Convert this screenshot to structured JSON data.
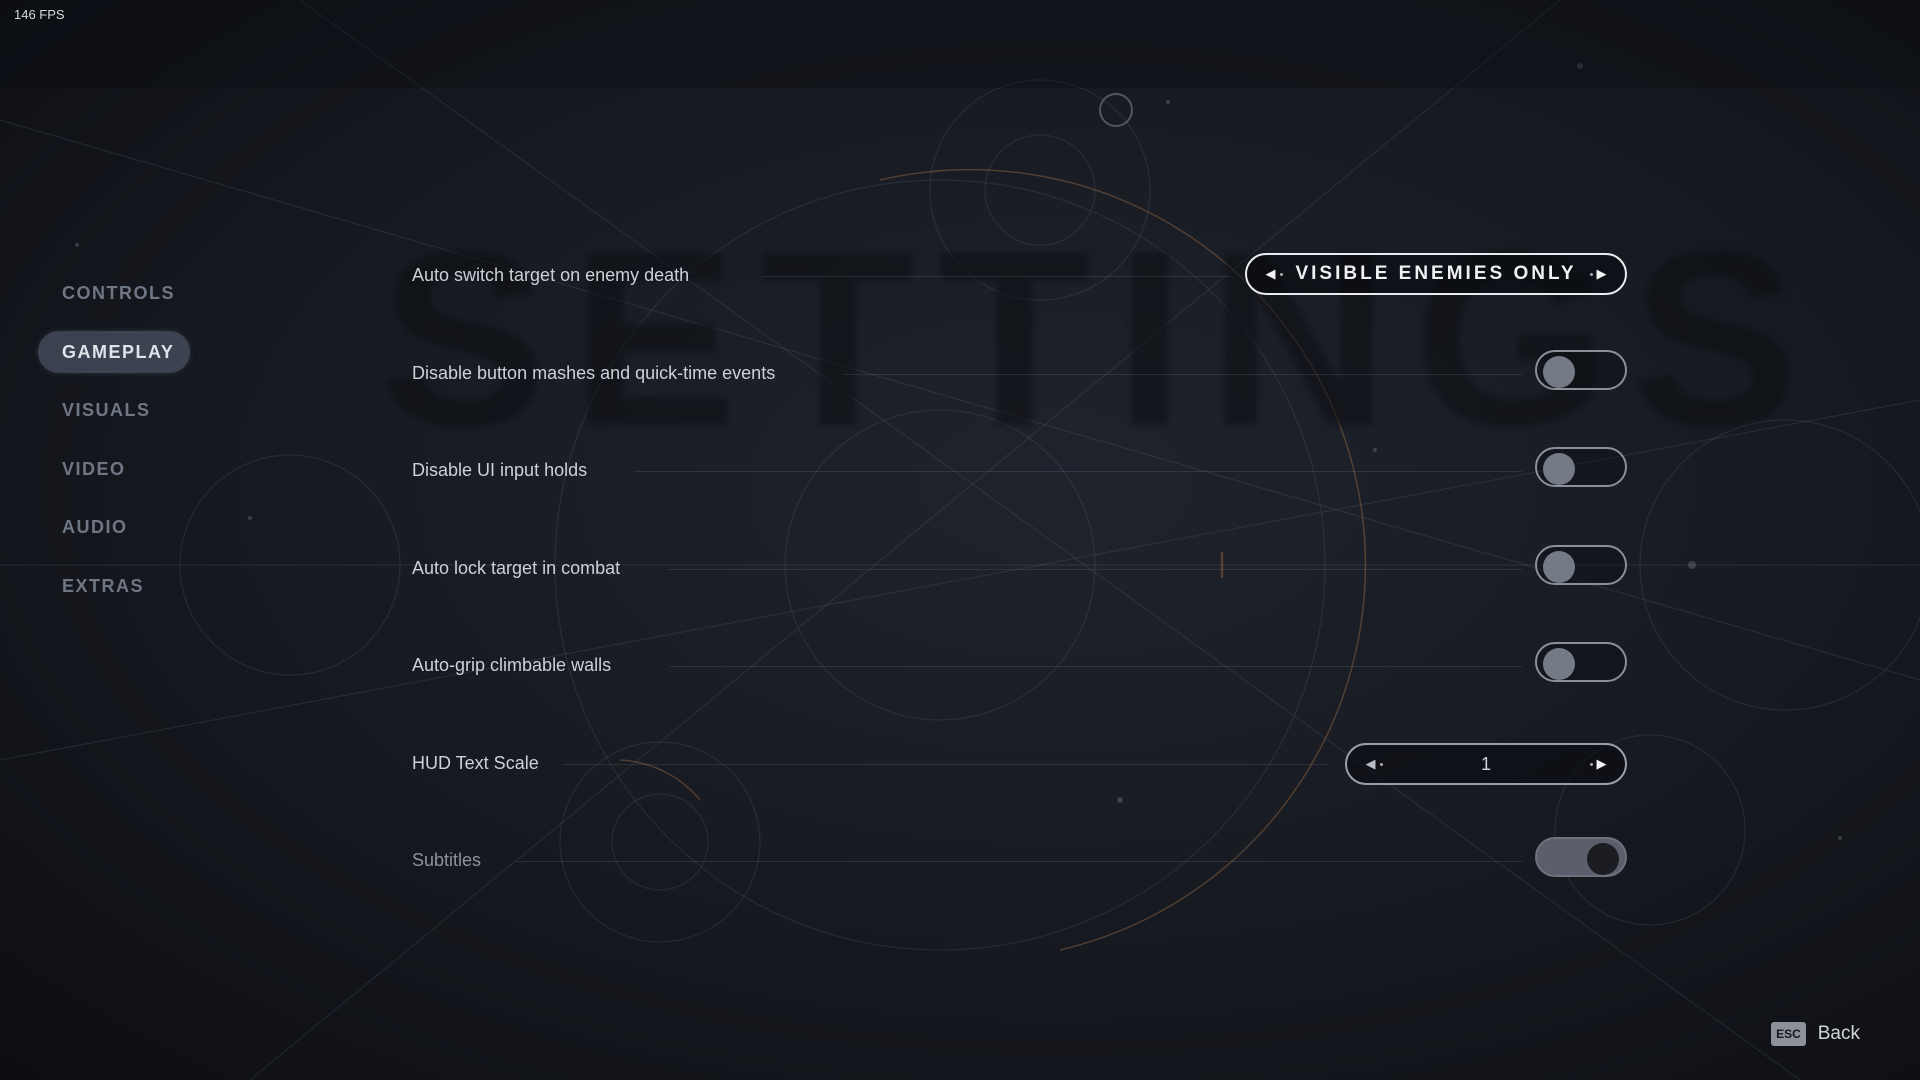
{
  "hud": {
    "fps": "146 FPS"
  },
  "background": {
    "title": "SETTINGS"
  },
  "sidebar": {
    "items": [
      {
        "label": "CONTROLS",
        "active": false
      },
      {
        "label": "GAMEPLAY",
        "active": true
      },
      {
        "label": "VISUALS",
        "active": false
      },
      {
        "label": "VIDEO",
        "active": false
      },
      {
        "label": "AUDIO",
        "active": false
      },
      {
        "label": "EXTRAS",
        "active": false
      }
    ]
  },
  "settings": [
    {
      "label": "Auto switch target on enemy death",
      "type": "selector",
      "value": "VISIBLE ENEMIES ONLY"
    },
    {
      "label": "Disable button mashes and quick-time events",
      "type": "toggle",
      "on": false
    },
    {
      "label": "Disable UI input holds",
      "type": "toggle",
      "on": false
    },
    {
      "label": "Auto lock target in combat",
      "type": "toggle",
      "on": false
    },
    {
      "label": "Auto-grip climbable walls",
      "type": "toggle",
      "on": false
    },
    {
      "label": "HUD Text Scale",
      "type": "stepper",
      "value": "1"
    },
    {
      "label": "Subtitles",
      "type": "toggle",
      "on": true
    }
  ],
  "footer": {
    "key": "ESC",
    "label": "Back"
  },
  "colors": {
    "active_tab_bg": "#3c4250",
    "accent_line": "#b07a4a",
    "background": "#181b22"
  }
}
